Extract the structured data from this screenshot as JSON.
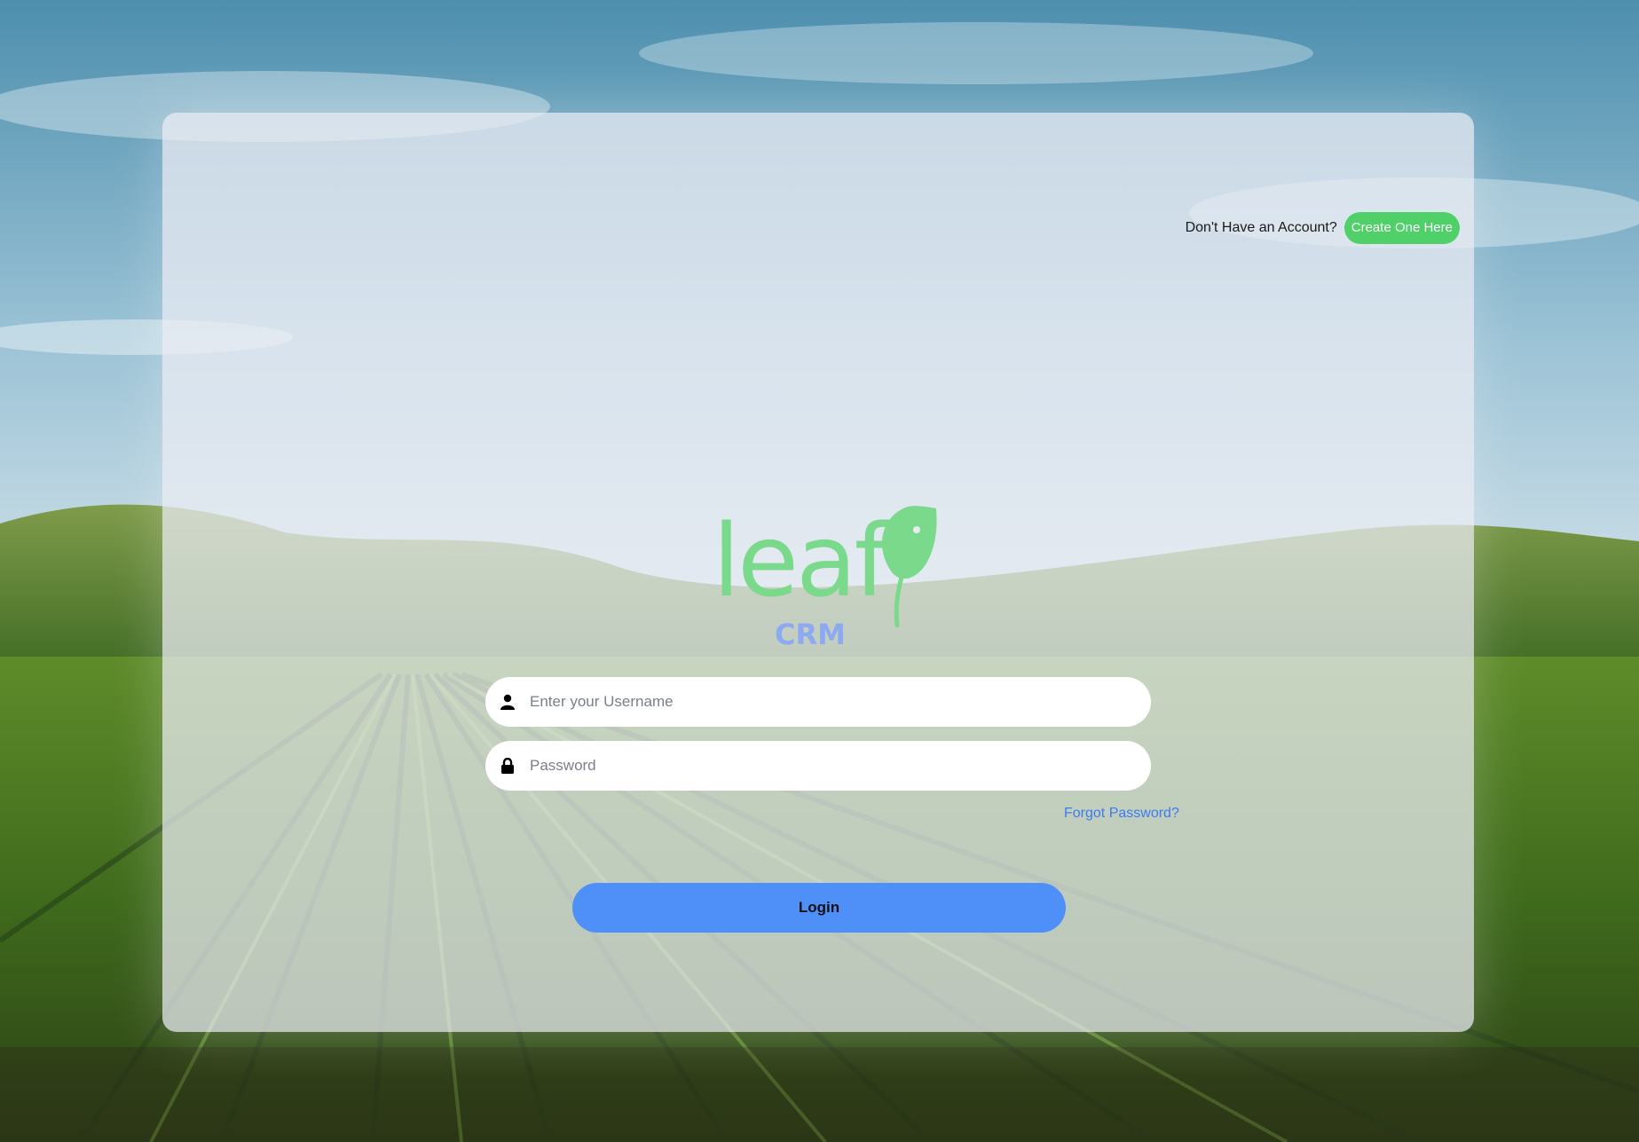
{
  "signup": {
    "prompt": "Don't Have an Account?",
    "button_label": "Create One Here"
  },
  "logo": {
    "word": "leaf",
    "sub": "CRM"
  },
  "form": {
    "username_placeholder": "Enter your Username",
    "password_placeholder": "Password",
    "forgot_label": "Forgot Password?",
    "login_label": "Login"
  },
  "colors": {
    "brand_green": "#7ad98a",
    "brand_blue": "#8da9f2",
    "create_button": "#4fd068",
    "login_button": "#4f8ff8",
    "link": "#3b7bf2"
  },
  "icons": {
    "username": "user-icon",
    "password": "lock-icon",
    "logo_mark": "leaf-icon"
  }
}
